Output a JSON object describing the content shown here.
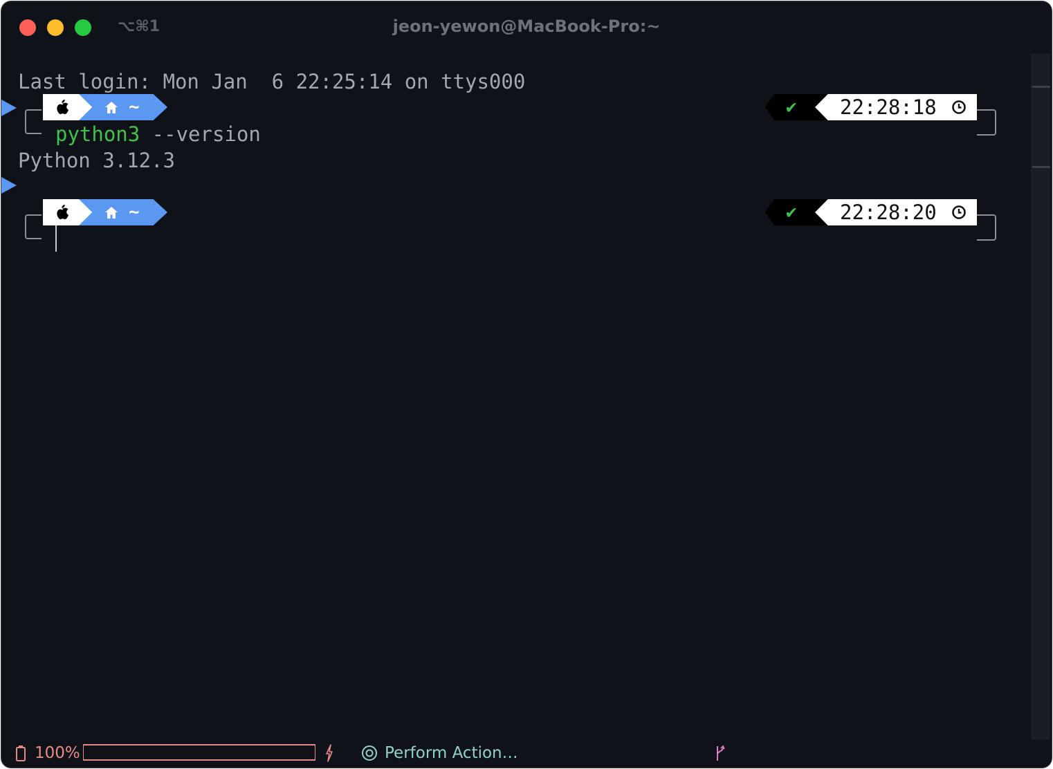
{
  "window": {
    "title": "jeon-yewon@MacBook-Pro:~",
    "shortcut": "⌥⌘1"
  },
  "terminal": {
    "last_login": "Last login: Mon Jan  6 22:25:14 on ttys000",
    "prompts": [
      {
        "dir_symbol": "~",
        "command_name": "python3",
        "command_args": " --version",
        "output": "Python 3.12.3",
        "status_symbol": "✔",
        "time": "22:28:18"
      },
      {
        "dir_symbol": "~",
        "command_name": "",
        "command_args": "",
        "output": "",
        "status_symbol": "✔",
        "time": "22:28:20"
      }
    ]
  },
  "statusbar": {
    "battery_percent_label": "100%",
    "battery_level": 1.0,
    "action_label": "Perform Action…"
  },
  "colors": {
    "background": "#0f1218",
    "prompt_blue": "#5b98f2",
    "command_green": "#3ec24a",
    "battery_red": "#e88b84",
    "action_teal": "#8fd3c9"
  },
  "icons": [
    "apple-icon",
    "home-icon",
    "check-icon",
    "clock-icon",
    "battery-icon",
    "bolt-icon",
    "target-icon",
    "branch-icon"
  ]
}
